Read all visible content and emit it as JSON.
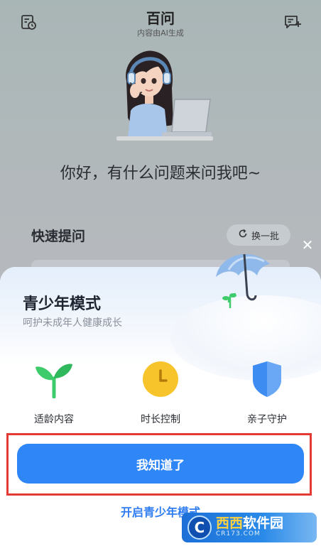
{
  "header": {
    "title": "百问",
    "subtitle": "内容由AI生成",
    "left_icon": "history-icon",
    "right_icon": "new-chat-icon"
  },
  "greeting": "你好，有什么问题来问我吧~",
  "quick": {
    "title": "快速提问",
    "refresh_label": "换一批"
  },
  "sheet": {
    "title": "青少年模式",
    "subtitle": "呵护未成年人健康成长",
    "features": [
      {
        "label": "适龄内容",
        "icon": "sprout-icon"
      },
      {
        "label": "时长控制",
        "icon": "clock-icon"
      },
      {
        "label": "亲子守护",
        "icon": "shield-icon"
      }
    ],
    "primary_button": "我知道了",
    "secondary_link": "开启青少年模式"
  },
  "watermark": {
    "brand_prefix": "西西",
    "brand_suffix": "软件园",
    "url": "CR173.COM"
  },
  "colors": {
    "accent": "#2f86f6",
    "highlight_border": "#e53935",
    "sprout": "#3ecb6b",
    "clock": "#f7c52b",
    "shield": "#3d8cf2"
  }
}
